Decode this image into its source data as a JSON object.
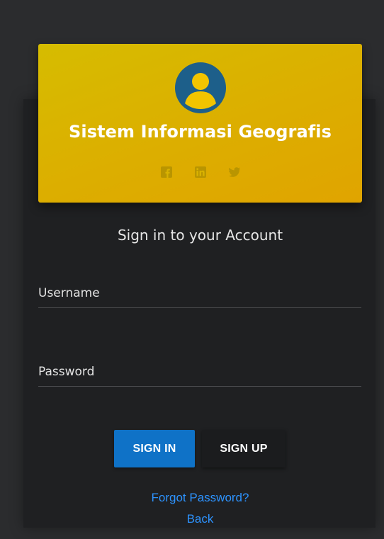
{
  "header": {
    "title": "Sistem Informasi Geografis",
    "avatar_icon": "user-avatar-icon",
    "socials": [
      {
        "icon": "facebook-icon"
      },
      {
        "icon": "linkedin-icon"
      },
      {
        "icon": "twitter-icon"
      }
    ],
    "colors": {
      "gradient_start": "#d6bc00",
      "gradient_end": "#e0a400",
      "avatar": "#1d5f8a"
    }
  },
  "form": {
    "heading": "Sign in to your Account",
    "username": {
      "placeholder": "Username",
      "value": ""
    },
    "password": {
      "placeholder": "Password",
      "value": ""
    },
    "signin_label": "SIGN IN",
    "signup_label": "SIGN UP",
    "forgot_label": "Forgot Password?",
    "back_label": "Back"
  },
  "colors": {
    "primary_button": "#0f72c7",
    "link": "#2d93ff",
    "card_bg": "#1f2022",
    "page_bg": "#2b2c2e"
  }
}
